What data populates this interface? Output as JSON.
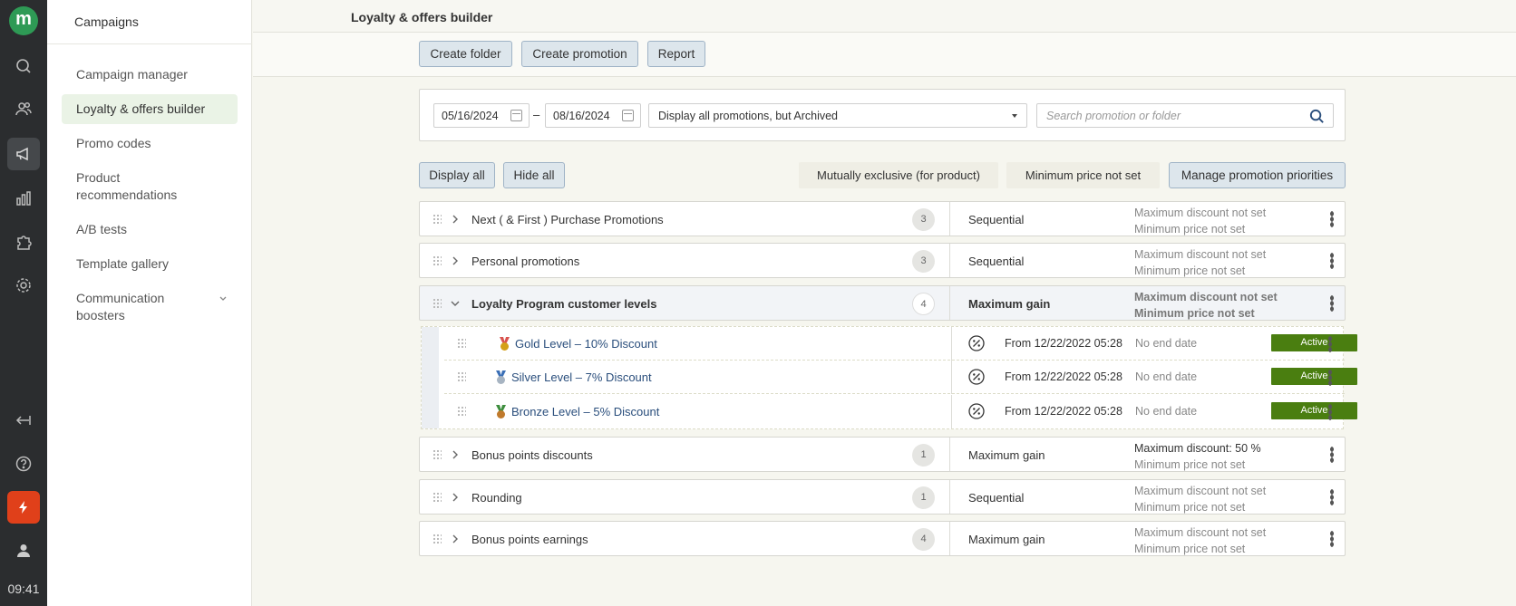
{
  "rail": {
    "logo": "m",
    "time": "09:41"
  },
  "sidebar": {
    "title": "Campaigns",
    "items": [
      {
        "label": "Campaign manager"
      },
      {
        "label": "Loyalty & offers builder"
      },
      {
        "label": "Promo codes"
      },
      {
        "label": "Product recommendations"
      },
      {
        "label": "A/B tests"
      },
      {
        "label": "Template gallery"
      },
      {
        "label": "Communication boosters"
      }
    ]
  },
  "header": {
    "title": "Loyalty & offers builder"
  },
  "toolbar": {
    "create_folder": "Create folder",
    "create_promotion": "Create promotion",
    "report": "Report"
  },
  "filters": {
    "date_from": "05/16/2024",
    "date_sep": "–",
    "date_to": "08/16/2024",
    "display_select": "Display all promotions, but Archived",
    "search_placeholder": "Search promotion or folder"
  },
  "list_controls": {
    "display_all": "Display all",
    "hide_all": "Hide all",
    "chip_exclusive": "Mutually exclusive (for product)",
    "chip_min_price": "Minimum price not set",
    "manage_priorities": "Manage promotion priorities"
  },
  "groups": [
    {
      "name": "Next ( & First ) Purchase Promotions",
      "count": "3",
      "mode": "Sequential",
      "info1": "Maximum discount not set",
      "info2": "Minimum price not set"
    },
    {
      "name": "Personal promotions",
      "count": "3",
      "mode": "Sequential",
      "info1": "Maximum discount not set",
      "info2": "Minimum price not set"
    },
    {
      "name": "Loyalty Program customer levels",
      "count": "4",
      "mode": "Maximum gain",
      "info1": "Maximum discount not set",
      "info2": "Minimum price not set"
    },
    {
      "name": "Bonus points discounts",
      "count": "1",
      "mode": "Maximum gain",
      "info1": "Maximum discount: 50 %",
      "info2": "Minimum price not set"
    },
    {
      "name": "Rounding",
      "count": "1",
      "mode": "Sequential",
      "info1": "Maximum discount not set",
      "info2": "Minimum price not set"
    },
    {
      "name": "Bonus points earnings",
      "count": "4",
      "mode": "Maximum gain",
      "info1": "Maximum discount not set",
      "info2": "Minimum price not set"
    }
  ],
  "children": [
    {
      "name": "Gold Level – 10% Discount",
      "status": "Active",
      "from": "From 12/22/2022 05:28",
      "end": "No end date",
      "medal_color": "#d4a017"
    },
    {
      "name": "Silver Level – 7% Discount",
      "status": "Active",
      "from": "From 12/22/2022 05:28",
      "end": "No end date",
      "medal_color": "#a7b4c2"
    },
    {
      "name": "Bronze Level – 5% Discount",
      "status": "Active",
      "from": "From 12/22/2022 05:28",
      "end": "No end date",
      "medal_color": "#c07a2c"
    }
  ],
  "colors": {
    "brand_green": "#2e9a55",
    "active_tag": "#4a7e10",
    "alert_button": "#e0401a"
  }
}
